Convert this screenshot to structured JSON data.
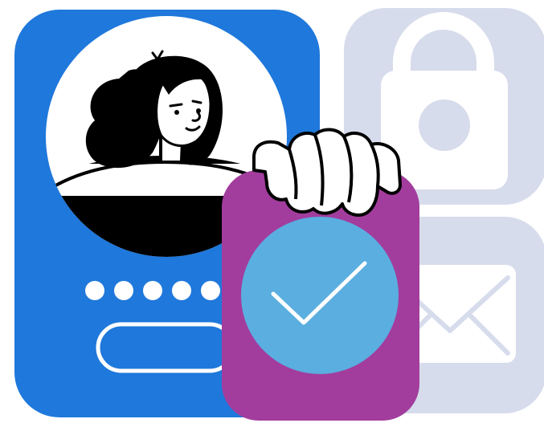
{
  "illustration": {
    "password_dots": [
      "",
      "",
      "",
      "",
      ""
    ],
    "background_tiles": [
      {
        "icon": "lock-icon"
      },
      {
        "icon": "envelope-icon"
      }
    ],
    "avatar": {
      "icon": "person-avatar-icon"
    },
    "verified_badge": {
      "icon": "checkmark-icon"
    }
  },
  "colors": {
    "phone_panel": "#1F78DB",
    "tile_background": "#D7DCEC",
    "tile_icon": "#FFFFFF",
    "badge_card": "#A23D9D",
    "check_circle": "#5AAEE0",
    "outline": "#000000",
    "white": "#FFFFFF"
  }
}
